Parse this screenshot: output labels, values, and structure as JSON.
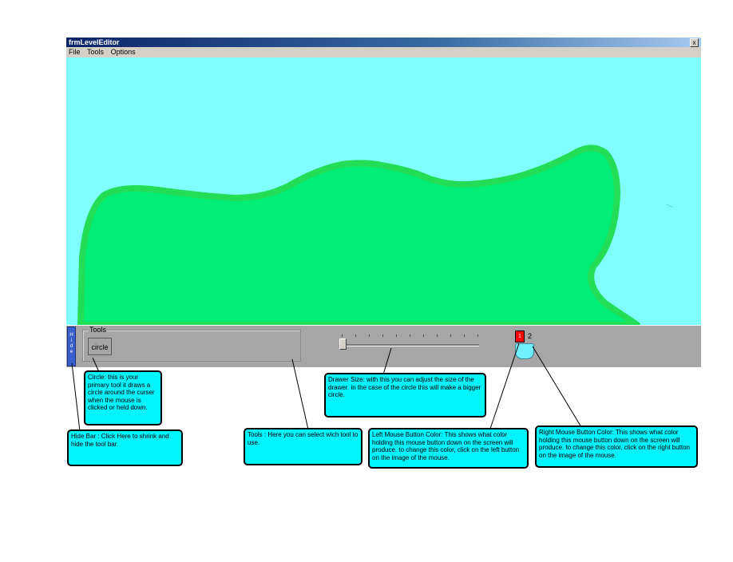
{
  "window": {
    "title": "frmLevelEditor",
    "close_glyph": "x"
  },
  "menu": [
    "File",
    "Tools",
    "Options"
  ],
  "toolbar": {
    "hide_bar_text": [
      "H",
      "i",
      "d",
      "e"
    ],
    "tools_group_label": "Tools",
    "circle_button": "circle",
    "drawer_size": 0,
    "left_mouse_color": "#ff0000",
    "left_mouse_label": "1",
    "right_mouse_label": "2",
    "right_mouse_color": "#80ffff"
  },
  "canvas": {
    "background": "#80ffff",
    "shape_fill": "#00ee77",
    "shape_outline": "#22dd55"
  },
  "annotations": {
    "circle": "Circle: this is your primary tool it draws a circle around the curser when the mouse is clicked or held down.",
    "drawer_size": "Drawer Size: with this you can adjust the size of the drawer. in the case of the circle this will make a bigger circle.",
    "hide_bar": "Hide Bar : Click Here to shrink and hide the tool bar.",
    "tools": "Tools : Here you can select wich tool to use.",
    "left_mouse": "Left Mouse Button Color: This shows what color holding this mouse button down on the screen will produce. to change this color, click on the left button on the image of the mouse.",
    "right_mouse": "Right Mouse Button Color: This shows what color holding this mouse button down on the screen will produce. to change this color, click on the right button on the image of the mouse."
  }
}
